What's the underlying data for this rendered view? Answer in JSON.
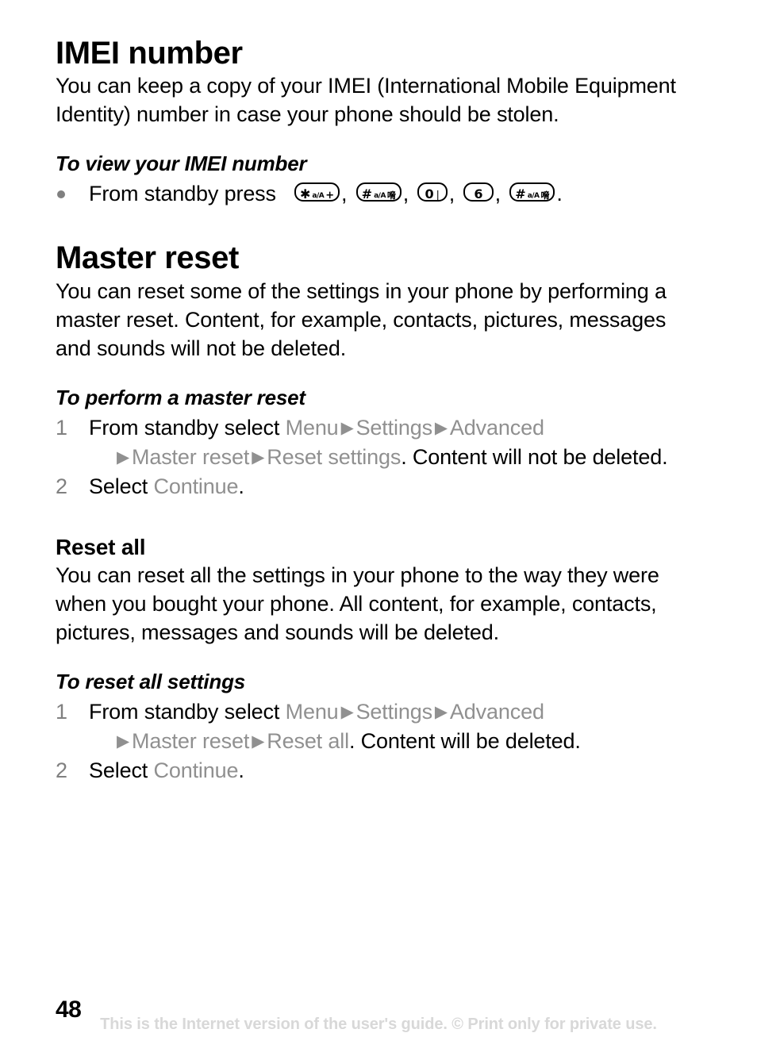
{
  "document": {
    "page_number": "48",
    "watermark": "This is the Internet version of the user's guide. © Print only for private use."
  },
  "sections": [
    {
      "heading": "IMEI number",
      "paragraph": "You can keep a copy of your IMEI (International Mobile Equipment Identity) number in case your phone should be stolen.",
      "procedure": {
        "title": "To view your IMEI number",
        "bullet_prefix": "From standby press",
        "keys": [
          {
            "name": "star-key",
            "main": "✱",
            "small": "a/A",
            "extra": "+"
          },
          {
            "name": "hash-key",
            "main": "#",
            "small": "a/A",
            "extra": "卋"
          },
          {
            "name": "zero-key",
            "main": "0",
            "small": "",
            "extra": "⌴"
          },
          {
            "name": "six-key",
            "main": "6",
            "small": "",
            "extra": ""
          },
          {
            "name": "hash-key",
            "main": "#",
            "small": "a/A",
            "extra": "卋"
          }
        ],
        "separator": ",",
        "terminator": "."
      }
    },
    {
      "heading": "Master reset",
      "paragraph": "You can reset some of the settings in your phone by performing a master reset. Content, for example, contacts, pictures, messages and sounds will not be deleted.",
      "procedure": {
        "title": "To perform a master reset",
        "steps": [
          {
            "number": "1",
            "lead": "From standby select ",
            "path": [
              "Menu",
              "Settings",
              "Advanced",
              "Master reset",
              "Reset settings"
            ],
            "trail": ". Content will not be deleted."
          },
          {
            "number": "2",
            "lead": "Select ",
            "path": [
              "Continue"
            ],
            "trail": "."
          }
        ]
      }
    },
    {
      "heading": "Reset all",
      "paragraph": "You can reset all the settings in your phone to the way they were when you bought your phone. All content, for example, contacts, pictures, messages and sounds will be deleted.",
      "procedure": {
        "title": "To reset all settings",
        "steps": [
          {
            "number": "1",
            "lead": "From standby select ",
            "path": [
              "Menu",
              "Settings",
              "Advanced",
              "Master reset",
              "Reset all"
            ],
            "trail": ". Content will be deleted."
          },
          {
            "number": "2",
            "lead": "Select ",
            "path": [
              "Continue"
            ],
            "trail": "."
          }
        ]
      }
    }
  ],
  "colors": {
    "text": "#000000",
    "menu_gray": "#909090",
    "marker_gray": "#808080",
    "watermark_gray": "#d8d8d8",
    "background": "#ffffff"
  }
}
